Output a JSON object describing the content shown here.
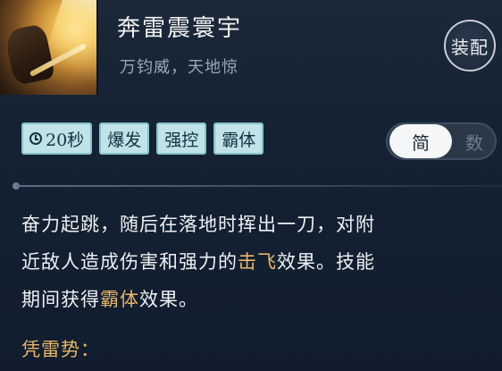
{
  "skill": {
    "name": "奔雷震寰宇",
    "tagline": "万钧威，天地惊",
    "equip_label": "装配"
  },
  "tags": [
    {
      "label": "20秒",
      "icon": "clock-icon"
    },
    {
      "label": "爆发"
    },
    {
      "label": "强控"
    },
    {
      "label": "霸体"
    }
  ],
  "toggle": {
    "simple_label": "简",
    "detail_label": "数",
    "selected": "简"
  },
  "description": {
    "line1": "奋力起跳，随后在落地时挥出一刀，对附",
    "line2_a": "近敌人造成伤害和强力的",
    "line2_hl": "击飞",
    "line2_b": "效果。技能",
    "line3_a": "期间获得",
    "line3_hl": "霸体",
    "line3_b": "效果。",
    "sub_heading": "凭雷势："
  },
  "colors": {
    "highlight": "#e7b66a",
    "tag_bg": "#bfe3e6",
    "panel_bg": "#152335"
  }
}
